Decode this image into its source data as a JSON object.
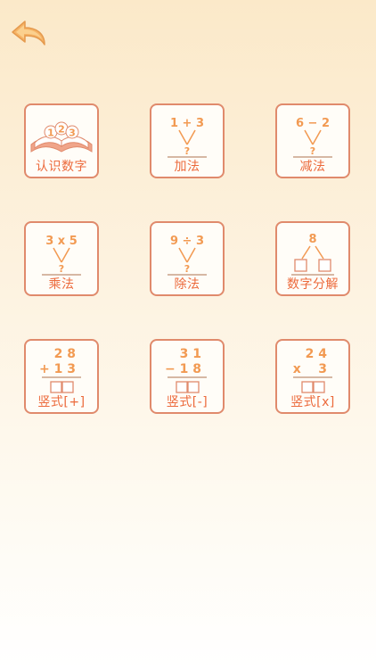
{
  "nav": {
    "back_icon": "back-arrow-icon"
  },
  "tiles": [
    {
      "label": "认识数字",
      "icon": "open-book-icon",
      "digits": [
        "1",
        "2",
        "3"
      ]
    },
    {
      "label": "加法",
      "expr": "1 + 3",
      "question": "?"
    },
    {
      "label": "减法",
      "expr": "6 − 2",
      "question": "?"
    },
    {
      "label": "乘法",
      "expr": "3 x 5",
      "question": "?"
    },
    {
      "label": "除法",
      "expr": "9 ÷ 3",
      "question": "?"
    },
    {
      "label": "数字分解",
      "top": "8"
    },
    {
      "label": "竖式[+]",
      "line1": "2 8",
      "line2": "+ 1 3"
    },
    {
      "label": "竖式[-]",
      "line1": "3 1",
      "line2": "− 1 8"
    },
    {
      "label": "竖式[x]",
      "line1": "2 4",
      "line2": "x    3"
    }
  ],
  "colors": {
    "accent": "#ec6a3c",
    "border": "#e08a6c",
    "number": "#f29a52"
  }
}
